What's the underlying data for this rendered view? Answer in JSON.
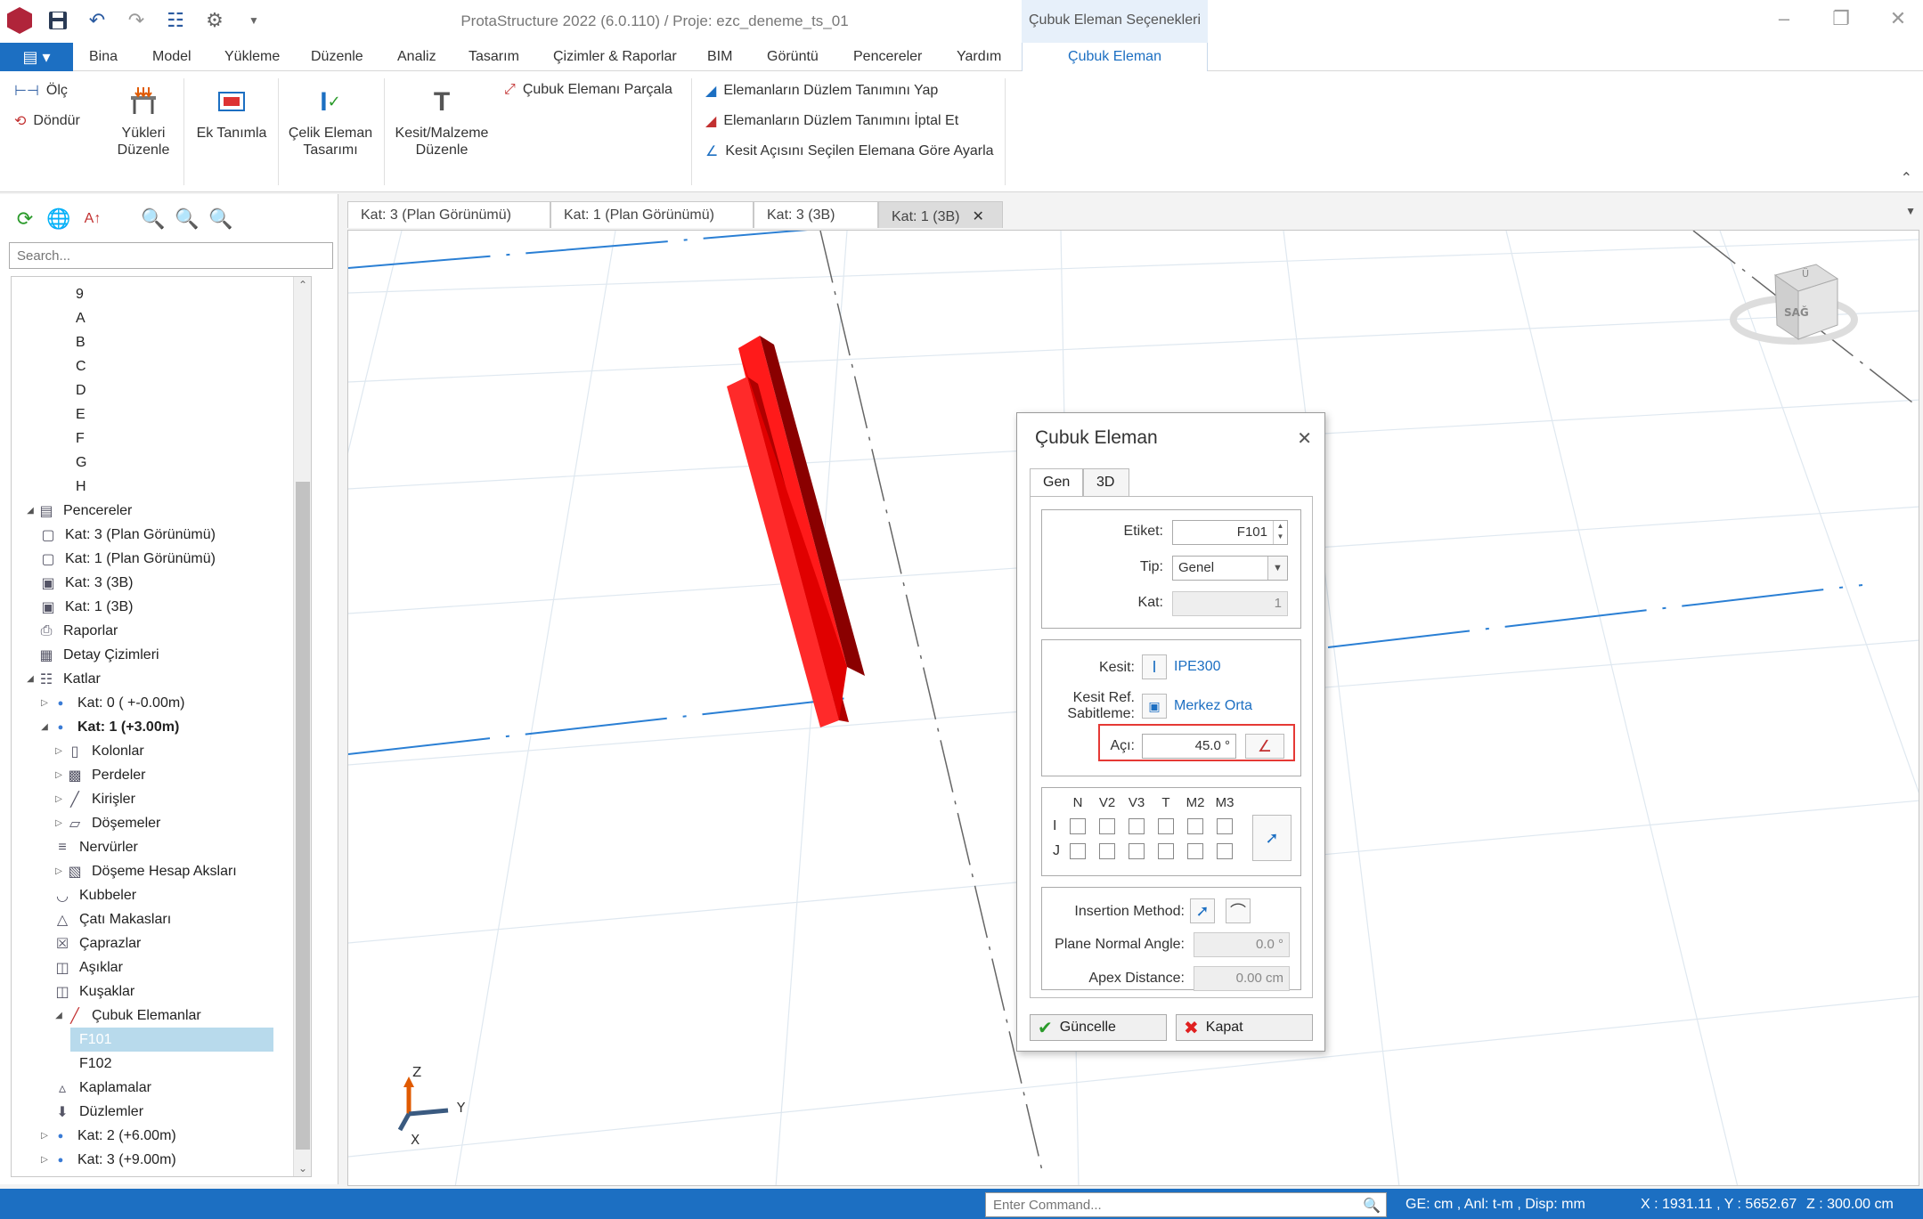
{
  "titlebar": {
    "title": "ProtaStructure 2022 (6.0.110) / Proje: ezc_deneme_ts_01",
    "context_header": "Çubuk Eleman Seçenekleri"
  },
  "menu": {
    "tabs": [
      "Bina",
      "Model",
      "Yükleme",
      "Düzenle",
      "Analiz",
      "Tasarım",
      "Çizimler & Raporlar",
      "BIM",
      "Görüntü",
      "Pencereler",
      "Yardım"
    ],
    "context_tab": "Çubuk Eleman"
  },
  "ribbon": {
    "olc": "Ölç",
    "dondur": "Döndür",
    "yukleri_duzenle": "Yükleri Düzenle",
    "ek_tanimla": "Ek Tanımla",
    "celik_eleman_tasarimi": "Çelik Eleman Tasarımı",
    "kesit_malzeme_duzenle": "Kesit/Malzeme Düzenle",
    "cubuk_parcala": "Çubuk Elemanı Parçala",
    "duzlem_yap": "Elemanların Düzlem Tanımını Yap",
    "duzlem_iptal": "Elemanların Düzlem Tanımını İptal Et",
    "kesit_acisi": "Kesit Açısını Seçilen Elemana Göre Ayarla"
  },
  "leftpanel": {
    "search_placeholder": "Search...",
    "tree": [
      {
        "label": "9",
        "indent": 1,
        "icon": "",
        "exp": ""
      },
      {
        "label": "A",
        "indent": 1,
        "icon": "",
        "exp": ""
      },
      {
        "label": "B",
        "indent": 1,
        "icon": "",
        "exp": ""
      },
      {
        "label": "C",
        "indent": 1,
        "icon": "",
        "exp": ""
      },
      {
        "label": "D",
        "indent": 1,
        "icon": "",
        "exp": ""
      },
      {
        "label": "E",
        "indent": 1,
        "icon": "",
        "exp": ""
      },
      {
        "label": "F",
        "indent": 1,
        "icon": "",
        "exp": ""
      },
      {
        "label": "G",
        "indent": 1,
        "icon": "",
        "exp": ""
      },
      {
        "label": "H",
        "indent": 1,
        "icon": "",
        "exp": ""
      },
      {
        "label": "Pencereler",
        "indent": 0,
        "icon": "windows-icon",
        "exp": "open"
      },
      {
        "label": "Kat: 3 (Plan Görünümü)",
        "indent": 1,
        "icon": "plan-view-icon",
        "exp": ""
      },
      {
        "label": "Kat: 1 (Plan Görünümü)",
        "indent": 1,
        "icon": "plan-view-icon",
        "exp": ""
      },
      {
        "label": "Kat: 3 (3B)",
        "indent": 1,
        "icon": "3d-view-icon",
        "exp": ""
      },
      {
        "label": "Kat: 1 (3B)",
        "indent": 1,
        "icon": "3d-view-icon",
        "exp": ""
      },
      {
        "label": "Raporlar",
        "indent": 0,
        "icon": "printer-icon",
        "exp": "none"
      },
      {
        "label": "Detay Çizimleri",
        "indent": 0,
        "icon": "drawing-icon",
        "exp": "none"
      },
      {
        "label": "Katlar",
        "indent": 0,
        "icon": "storeys-icon",
        "exp": "open"
      },
      {
        "label": "Kat: 0 ( +-0.00m)",
        "indent": 1,
        "icon": "storey-dot-icon",
        "exp": "closed"
      },
      {
        "label": "Kat: 1 (+3.00m)",
        "indent": 1,
        "icon": "storey-dot-icon",
        "exp": "open",
        "bold": true
      },
      {
        "label": "Kolonlar",
        "indent": 2,
        "icon": "column-icon",
        "exp": "closed"
      },
      {
        "label": "Perdeler",
        "indent": 2,
        "icon": "wall-icon",
        "exp": "closed"
      },
      {
        "label": "Kirişler",
        "indent": 2,
        "icon": "beam-icon",
        "exp": "closed"
      },
      {
        "label": "Döşemeler",
        "indent": 2,
        "icon": "slab-icon",
        "exp": "closed"
      },
      {
        "label": "Nervürler",
        "indent": 2,
        "icon": "rib-icon",
        "exp": ""
      },
      {
        "label": "Döşeme Hesap Aksları",
        "indent": 2,
        "icon": "slab-axis-icon",
        "exp": "closed"
      },
      {
        "label": "Kubbeler",
        "indent": 2,
        "icon": "dome-icon",
        "exp": ""
      },
      {
        "label": "Çatı Makasları",
        "indent": 2,
        "icon": "truss-icon",
        "exp": ""
      },
      {
        "label": "Çaprazlar",
        "indent": 2,
        "icon": "brace-icon",
        "exp": ""
      },
      {
        "label": "Aşıklar",
        "indent": 2,
        "icon": "purlin-icon",
        "exp": ""
      },
      {
        "label": "Kuşaklar",
        "indent": 2,
        "icon": "girt-icon",
        "exp": ""
      },
      {
        "label": "Çubuk Elemanlar",
        "indent": 2,
        "icon": "member-icon",
        "exp": "open"
      },
      {
        "label": "F101",
        "indent": 3,
        "icon": "",
        "exp": "",
        "selected": true
      },
      {
        "label": "F102",
        "indent": 3,
        "icon": "",
        "exp": ""
      },
      {
        "label": "Kaplamalar",
        "indent": 2,
        "icon": "cladding-icon",
        "exp": ""
      },
      {
        "label": "Düzlemler",
        "indent": 2,
        "icon": "plane-icon",
        "exp": ""
      },
      {
        "label": "Kat: 2 (+6.00m)",
        "indent": 1,
        "icon": "storey-dot-icon",
        "exp": "closed"
      },
      {
        "label": "Kat: 3 (+9.00m)",
        "indent": 1,
        "icon": "storey-dot-icon",
        "exp": "closed"
      }
    ]
  },
  "doctabs": {
    "tab1": "Kat: 3 (Plan Görünümü)",
    "tab2": "Kat: 1 (Plan Görünümü)",
    "tab3": "Kat: 3 (3B)",
    "tab4": "Kat: 1 (3B)"
  },
  "viewport": {
    "axis_z": "Z",
    "axis_y": "Y",
    "axis_x": "X",
    "navcube_label": "SAĞ",
    "navcube_top": "Ü"
  },
  "dialog": {
    "title": "Çubuk Eleman",
    "tab_gen": "Gen",
    "tab_3d": "3D",
    "etiket_label": "Etiket:",
    "etiket_value": "F101",
    "tip_label": "Tip:",
    "tip_value": "Genel",
    "kat_label": "Kat:",
    "kat_value": "1",
    "kesit_label": "Kesit:",
    "kesit_value": "IPE300",
    "kesit_ref_label_1": "Kesit Ref.",
    "kesit_ref_label_2": "Sabitleme:",
    "kesit_ref_value": "Merkez Orta",
    "aci_label": "Açı:",
    "aci_value": "45.0 °",
    "releases": [
      "N",
      "V2",
      "V3",
      "T",
      "M2",
      "M3"
    ],
    "release_rows": [
      "I",
      "J"
    ],
    "insertion_label": "Insertion Method:",
    "plane_normal_label": "Plane Normal Angle:",
    "plane_normal_value": "0.0 °",
    "apex_label": "Apex Distance:",
    "apex_value": "0.00 cm",
    "guncelle": "Güncelle",
    "kapat": "Kapat"
  },
  "statusbar": {
    "command_placeholder": "Enter Command...",
    "units": "GE: cm , Anl: t-m , Disp: mm",
    "coords": "X : 1931.11 , Y : 5652.67",
    "z": "Z : 300.00 cm"
  },
  "colors": {
    "accent": "#1c6fc2",
    "member_red": "#ff1a1a",
    "grid_blue": "#2a7fd4",
    "highlight_red": "#e53935"
  }
}
